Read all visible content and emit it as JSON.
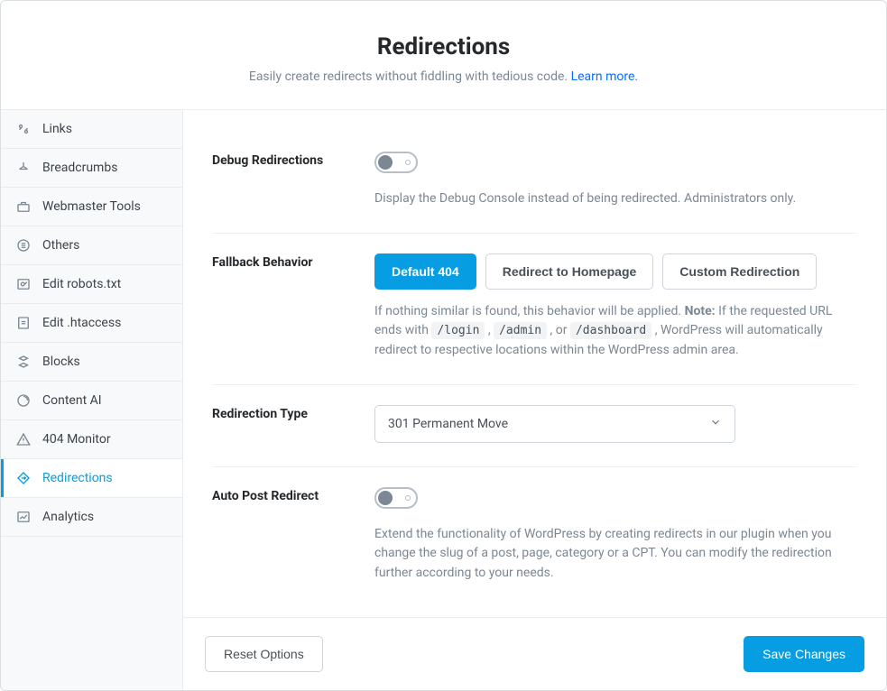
{
  "header": {
    "title": "Redirections",
    "subtitle": "Easily create redirects without fiddling with tedious code. ",
    "learn_more": "Learn more."
  },
  "sidebar": {
    "items": [
      {
        "label": "Links"
      },
      {
        "label": "Breadcrumbs"
      },
      {
        "label": "Webmaster Tools"
      },
      {
        "label": "Others"
      },
      {
        "label": "Edit robots.txt"
      },
      {
        "label": "Edit .htaccess"
      },
      {
        "label": "Blocks"
      },
      {
        "label": "Content AI"
      },
      {
        "label": "404 Monitor"
      },
      {
        "label": "Redirections"
      },
      {
        "label": "Analytics"
      }
    ]
  },
  "settings": {
    "debug": {
      "label": "Debug Redirections",
      "help": "Display the Debug Console instead of being redirected. Administrators only."
    },
    "fallback": {
      "label": "Fallback Behavior",
      "options": [
        "Default 404",
        "Redirect to Homepage",
        "Custom Redirection"
      ],
      "help_pre": "If nothing similar is found, this behavior will be applied. ",
      "help_note_label": "Note:",
      "help_note_1": " If the requested URL ends with ",
      "code1": "/login",
      "sep": " , ",
      "code2": "/admin",
      "or": " , or ",
      "code3": "/dashboard",
      "help_note_2": " , WordPress will automatically redirect to respective locations within the WordPress admin area."
    },
    "redir_type": {
      "label": "Redirection Type",
      "selected": "301 Permanent Move"
    },
    "auto_post": {
      "label": "Auto Post Redirect",
      "help": "Extend the functionality of WordPress by creating redirects in our plugin when you change the slug of a post, page, category or a CPT. You can modify the redirection further according to your needs."
    }
  },
  "footer": {
    "reset": "Reset Options",
    "save": "Save Changes"
  }
}
